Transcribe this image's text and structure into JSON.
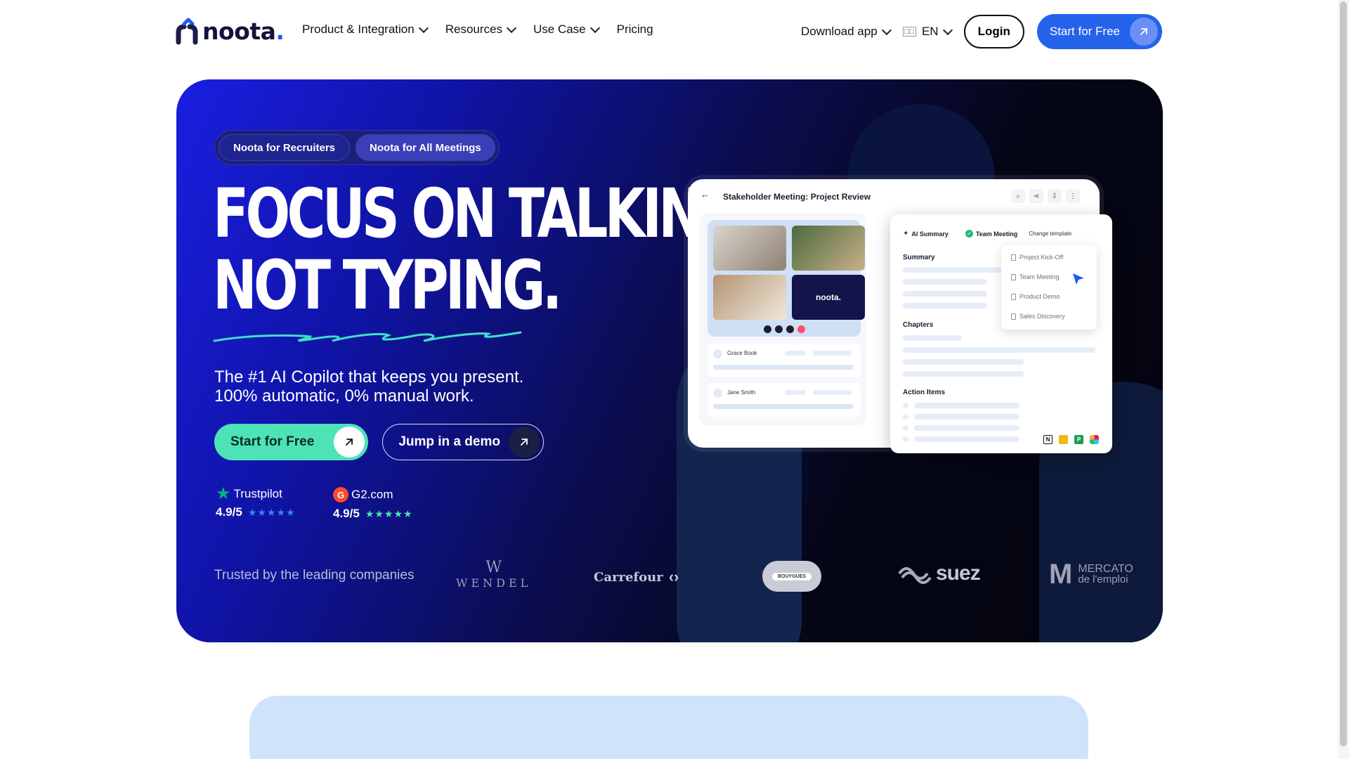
{
  "brand": {
    "name": "noota",
    "dot": ".",
    "color": "#1f5cf5"
  },
  "nav": {
    "links": [
      {
        "label": "Product & Integration",
        "dropdown": true
      },
      {
        "label": "Resources",
        "dropdown": true
      },
      {
        "label": "Use Case",
        "dropdown": true
      },
      {
        "label": "Pricing",
        "dropdown": false
      }
    ],
    "download": "Download app",
    "language": "EN",
    "login": "Login",
    "start": "Start for Free"
  },
  "hero": {
    "tabs": [
      "Noota for Recruiters",
      "Noota for All Meetings"
    ],
    "headline": [
      "FOCUS ON TALKING,",
      "NOT TYPING."
    ],
    "subline1": "The #1 AI Copilot that keeps you present.",
    "subline2": "100% automatic, 0% manual work.",
    "cta_primary": "Start for Free",
    "cta_secondary": "Jump in a demo",
    "ratings": [
      {
        "brand": "Trustpilot",
        "score": "4.9/5",
        "stars": "★★★★★"
      },
      {
        "brand": "G2.com",
        "score": "4.9/5",
        "stars": "★★★★★"
      }
    ],
    "trusted_label": "Trusted by the leading companies",
    "companies": [
      "WENDEL",
      "Carrefour",
      "BOUYGUES",
      "suez",
      "MERCATO",
      "de l'emploi"
    ]
  },
  "mockup": {
    "title": "Stakeholder Meeting: Project Review",
    "video_logo": "noota.",
    "participants": [
      "Grace Book",
      "Jane Smith"
    ],
    "tabs": [
      "AI Summary",
      "Team Meeting",
      "Change template"
    ],
    "sections": [
      "Summary",
      "Chapters",
      "Action Items"
    ],
    "templates": [
      "Project Kick-Off",
      "Team Meeting",
      "Product Demo",
      "Sales Discovery"
    ]
  },
  "colors": {
    "hero_start": "#1a1fe0",
    "hero_end": "#03040c",
    "cta_green": "#4ee3b6",
    "primary_blue": "#2563eb"
  }
}
